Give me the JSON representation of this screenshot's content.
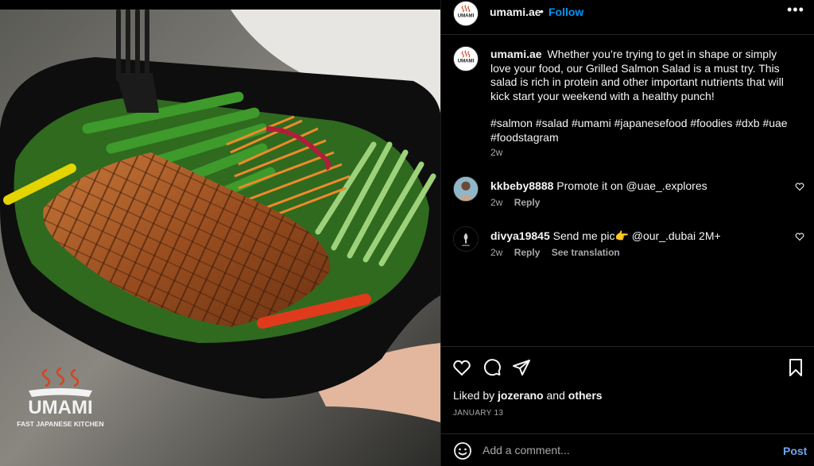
{
  "post": {
    "account": "umami.ae",
    "separator": "•",
    "follow_label": "Follow",
    "more_label": "•••",
    "caption": "Whether you’re trying to get in shape or simply love your food, our Grilled Salmon Salad is a must try. This salad is rich in protein and other important nutrients that will kick start your weekend with a healthy punch!",
    "hashtags": "#salmon #salad #umami #japanesefood #foodies #dxb #uae #foodstagram",
    "caption_time": "2w",
    "likes_prefix": "Liked by",
    "liked_by": "jozerano",
    "likes_and": "and",
    "likes_others": "others",
    "date": "JANUARY 13"
  },
  "logo": {
    "brand": "UMAMI",
    "tagline": "FAST JAPANESE KITCHEN"
  },
  "comments": [
    {
      "user": "kkbeby8888",
      "text": "Promote it on @uae_.explores",
      "time": "2w",
      "reply_label": "Reply"
    },
    {
      "user": "divya19845",
      "text": "Send me pic👉 @our_.dubai 2M+",
      "time": "2w",
      "reply_label": "Reply",
      "translate_label": "See translation"
    }
  ],
  "composer": {
    "placeholder": "Add a comment...",
    "post_label": "Post"
  },
  "icons": {
    "like": "heart-icon",
    "comment": "comment-icon",
    "share": "paper-plane-icon",
    "save": "bookmark-icon",
    "emoji": "emoji-icon"
  },
  "colors": {
    "accent": "#0095f6",
    "background": "#000000",
    "muted_text": "#a8a8a8"
  }
}
